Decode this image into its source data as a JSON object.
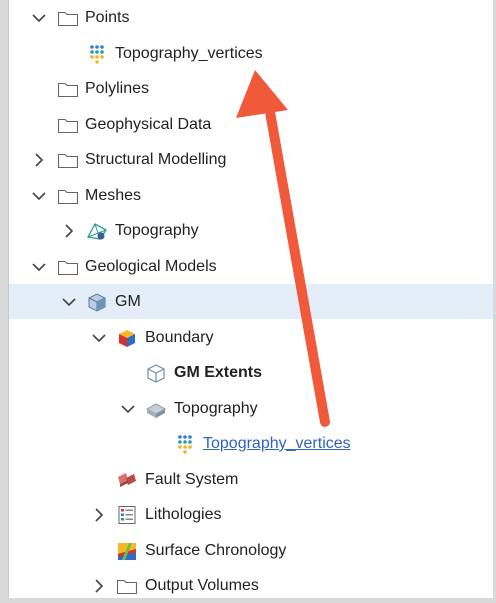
{
  "tree": {
    "items": [
      {
        "label": "Points"
      },
      {
        "label": "Topography_vertices"
      },
      {
        "label": "Polylines"
      },
      {
        "label": "Geophysical Data"
      },
      {
        "label": "Structural Modelling"
      },
      {
        "label": "Meshes"
      },
      {
        "label": "Topography"
      },
      {
        "label": "Geological Models"
      },
      {
        "label": "GM"
      },
      {
        "label": "Boundary"
      },
      {
        "label": "GM Extents"
      },
      {
        "label": "Topography"
      },
      {
        "label": "Topography_vertices"
      },
      {
        "label": "Fault System"
      },
      {
        "label": "Lithologies"
      },
      {
        "label": "Surface Chronology"
      },
      {
        "label": "Output Volumes"
      }
    ]
  },
  "icons": {
    "chevron_expanded": "chevron-down-icon",
    "chevron_collapsed": "chevron-right-icon",
    "folder": "folder-icon",
    "points": "points-dots-icon",
    "mesh": "mesh-icon",
    "model": "geological-model-icon",
    "boundary": "boundary-cube-icon",
    "extents": "extents-cube-icon",
    "surface": "surface-icon",
    "fault": "fault-system-icon",
    "lithologies": "lithologies-list-icon",
    "chronology": "surface-chronology-icon"
  },
  "colors": {
    "selection": "#e3eef9",
    "link": "#2f63c6",
    "annotation_arrow": "#f05a3a"
  }
}
